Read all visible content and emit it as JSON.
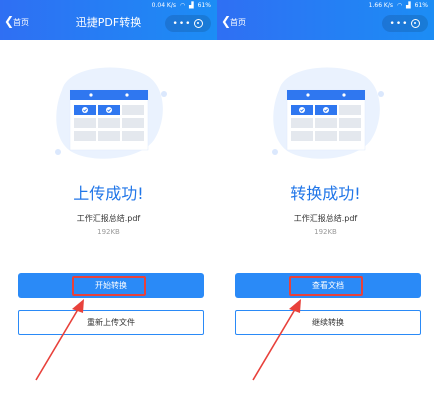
{
  "left": {
    "status": {
      "speed": "0.04 K/s",
      "battery": "61%"
    },
    "header": {
      "back": "首页",
      "title": "迅捷PDF转换",
      "capsule_dots": "•••"
    },
    "status_text": "上传成功!",
    "file_name": "工作汇报总结.pdf",
    "file_size": "192KB",
    "primary_button": "开始转换",
    "secondary_button": "重新上传文件"
  },
  "right": {
    "status": {
      "speed": "1.66 K/s",
      "battery": "61%"
    },
    "header": {
      "back": "首页",
      "title": "",
      "capsule_dots": "•••"
    },
    "status_text": "转换成功!",
    "file_name": "工作汇报总结.pdf",
    "file_size": "192KB",
    "primary_button": "查看文档",
    "secondary_button": "继续转换"
  },
  "colors": {
    "header": "#2f6ff3",
    "accent": "#2a8af7",
    "status_text": "#2176e8",
    "highlight": "#e8413b"
  },
  "icons": [
    "back-chevron-icon",
    "more-dots-icon",
    "target-icon",
    "wifi-icon",
    "signal-icon",
    "battery-icon",
    "table-illustration",
    "red-arrow-annotation"
  ]
}
